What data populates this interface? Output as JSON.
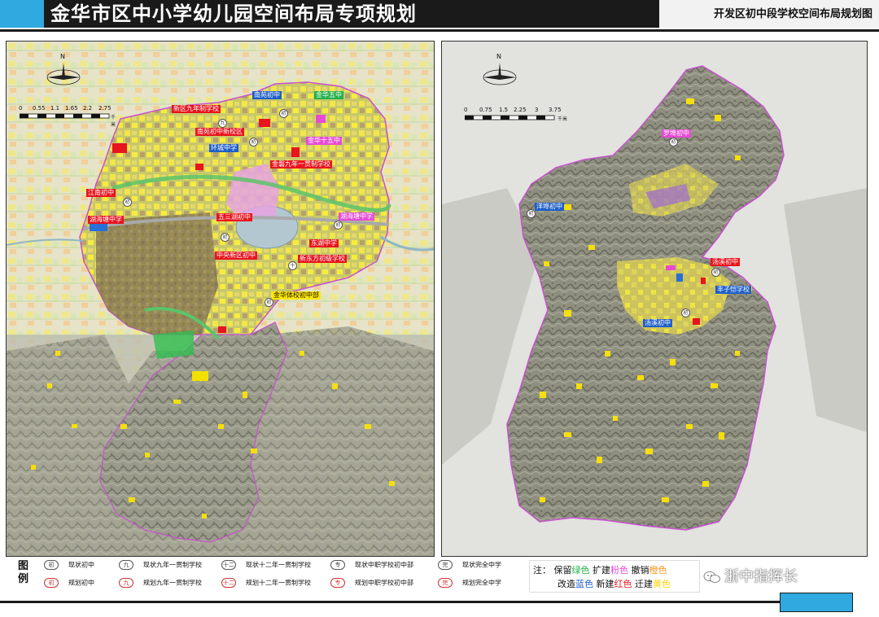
{
  "header": {
    "title": "金华市区中小学幼儿园空间布局专项规划",
    "subtitle": "开发区初中段学校空间布局规划图",
    "accent_color": "#2fa9e0",
    "bar_color": "#1a1a1a"
  },
  "left_map": {
    "compass_letter": "N",
    "scale_labels": [
      "0",
      "0.55",
      "1.1",
      "1.65",
      "2.2",
      "2.75"
    ],
    "scale_unit": "千米",
    "labels": [
      {
        "text": "南苑初中",
        "color": "blue"
      },
      {
        "text": "金华五中",
        "color": "green"
      },
      {
        "text": "新区九年制学校",
        "color": "red"
      },
      {
        "text": "南苑初中新校区",
        "color": "red"
      },
      {
        "text": "环城中学",
        "color": "blue"
      },
      {
        "text": "金华十五中",
        "color": "pink"
      },
      {
        "text": "金磐九年一贯制学校",
        "color": "red"
      },
      {
        "text": "湖海塘中学",
        "color": "pink"
      },
      {
        "text": "东湖中学",
        "color": "red"
      },
      {
        "text": "苏孟初中",
        "color": "red"
      },
      {
        "text": "五三湖初中",
        "color": "red"
      },
      {
        "text": "江南初中",
        "color": "red"
      },
      {
        "text": "中央新区初中",
        "color": "red"
      },
      {
        "text": "新东方初级学校",
        "color": "red"
      },
      {
        "text": "金华体校初中部",
        "color": "yellow"
      }
    ]
  },
  "right_map": {
    "compass_letter": "N",
    "scale_labels": [
      "0",
      "0.75",
      "1.5",
      "2.25",
      "3",
      "3.75"
    ],
    "scale_unit": "千米",
    "labels": [
      {
        "text": "罗埠初中",
        "color": "pink"
      },
      {
        "text": "洋埠初中",
        "color": "blue"
      },
      {
        "text": "汤溪初中",
        "color": "red"
      },
      {
        "text": "丰子恺学校",
        "color": "blue"
      },
      {
        "text": "汤溪初中",
        "color": "blue"
      }
    ]
  },
  "legend": {
    "caption": "图例",
    "rows": [
      [
        {
          "symbol": "初",
          "text": "现状初中",
          "state": "existing"
        },
        {
          "symbol": "九",
          "text": "现状九年一贯制学校",
          "state": "existing"
        },
        {
          "symbol": "十二",
          "text": "现状十二年一贯制学校",
          "state": "existing"
        },
        {
          "symbol": "专",
          "text": "现状中职学校初中部",
          "state": "existing"
        },
        {
          "symbol": "完",
          "text": "现状完全中学",
          "state": "existing"
        }
      ],
      [
        {
          "symbol": "初",
          "text": "规划初中",
          "state": "planned"
        },
        {
          "symbol": "九",
          "text": "规划九年一贯制学校",
          "state": "planned"
        },
        {
          "symbol": "十二",
          "text": "规划十二年一贯制学校",
          "state": "planned"
        },
        {
          "symbol": "专",
          "text": "规划中职学校初中部",
          "state": "planned"
        },
        {
          "symbol": "完",
          "text": "规划完全中学",
          "state": "planned"
        }
      ]
    ]
  },
  "note": {
    "prefix": "注：",
    "line1": [
      {
        "action": "保留",
        "color_word": "绿色",
        "cls": "green"
      },
      {
        "action": "扩建",
        "color_word": "粉色",
        "cls": "pink"
      },
      {
        "action": "撤销",
        "color_word": "橙色",
        "cls": "orange"
      }
    ],
    "line2": [
      {
        "action": "改造",
        "color_word": "蓝色",
        "cls": "blue"
      },
      {
        "action": "新建",
        "color_word": "红色",
        "cls": "red"
      },
      {
        "action": "迁建",
        "color_word": "黄色",
        "cls": "yellow"
      }
    ]
  },
  "watermark": {
    "text": "浙中指挥长",
    "icon": "wechat-icon"
  },
  "colors": {
    "green": "#22b14c",
    "blue": "#1f5fc8",
    "pink": "#e64bd4",
    "red": "#e8141e",
    "yellow": "#ffe600",
    "orange": "#f7941d"
  }
}
